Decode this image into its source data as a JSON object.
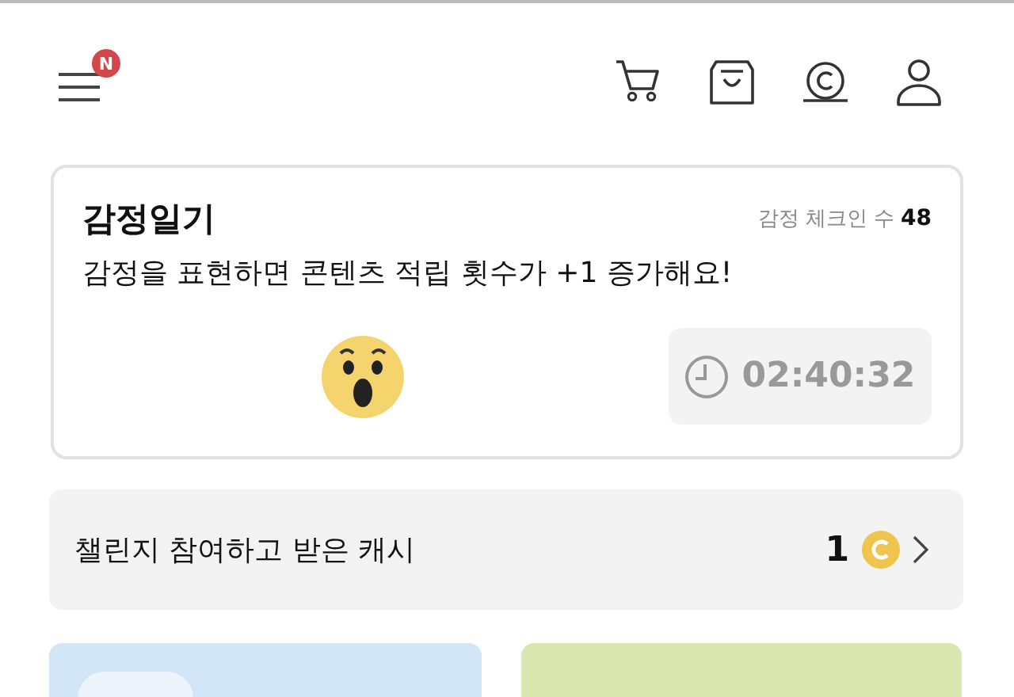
{
  "header": {
    "menu_badge": "N"
  },
  "emotion_card": {
    "title": "감정일기",
    "checkin_label": "감정 체크인 수",
    "checkin_count": "48",
    "description": "감정을 표현하면 콘텐츠 적립 횟수가 +1 증가해요!",
    "timer": "02:40:32"
  },
  "cash_row": {
    "label": "챌린지 참여하고 받은 캐시",
    "amount": "1"
  },
  "challenge_cards": [
    {
      "color": "#d2e6f8",
      "badge": true
    },
    {
      "color": "#d9e6b0",
      "badge": false
    }
  ]
}
